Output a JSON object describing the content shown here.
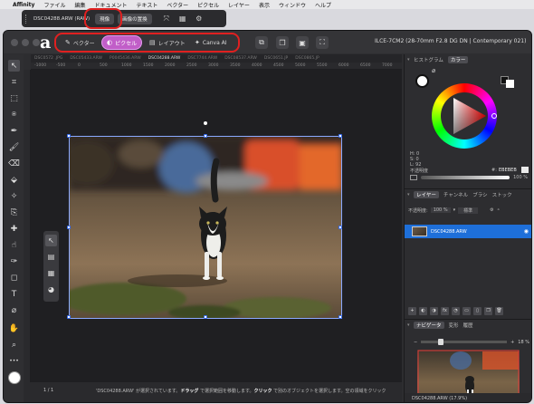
{
  "menubar": {
    "app": "Affinity",
    "items": [
      "ファイル",
      "編集",
      "ドキュメント",
      "テキスト",
      "ベクター",
      "ピクセル",
      "レイヤー",
      "表示",
      "ウィンドウ",
      "ヘルプ"
    ]
  },
  "context_toolbar": {
    "filename": "DSC04288.ARW (RAW)",
    "btn_image": "現像",
    "btn_replace": "画像の置換"
  },
  "personas": {
    "vector": "ベクター",
    "pixel": "ピクセル",
    "layout": "レイアウト",
    "canva": "Canva AI"
  },
  "doc_info": "ILCE-7CM2 (28-70mm F2.8 DG DN | Contemporary 021)",
  "tabs": [
    "DSC0572 .JPG",
    "DSC05433.ARW",
    "P0045436.ARW",
    "DSC04288.ARW",
    "DSC7744.ARW",
    "DSC08537.ARW",
    "DSC0651.JP",
    "DSC0865.JP"
  ],
  "ruler_ticks": [
    "-1000",
    "-500",
    "0",
    "500",
    "1000",
    "1500",
    "2000",
    "2500",
    "3000",
    "3500",
    "4000",
    "4500",
    "5000",
    "5500",
    "6000",
    "6500",
    "7000"
  ],
  "status": {
    "page": "1 / 1",
    "msg_prefix": "'DSC04288.ARW' が選択されています。",
    "drag": "ドラッグ",
    "msg_mid": " で選択範囲を移動します。",
    "click": "クリック",
    "msg_suffix": " で別のオブジェクトを選択します。空の領域をクリック"
  },
  "color_panel": {
    "tabs": [
      "ヒストグラム",
      "カラー"
    ],
    "active_tab": "カラー",
    "h": "H: 0",
    "s": "S: 0",
    "l": "L: 92",
    "hex_label": "#:",
    "hex_value": "EBEBEB",
    "opacity_label": "不透明度",
    "opacity_value": "100 %"
  },
  "layers_panel": {
    "tabs": [
      "レイヤー",
      "チャンネル",
      "ブラシ",
      "ストック"
    ],
    "opacity_label": "不透明度:",
    "opacity_value": "100 %",
    "blend_mode": "標準",
    "layer_name": "DSC04288.ARW"
  },
  "navigator_panel": {
    "tabs": [
      "ナビゲータ",
      "変形",
      "履歴"
    ],
    "zoom_value": "18 %",
    "caption": "DSC04288.ARW (17.9%)"
  },
  "icons": [
    "apple-icon",
    "move-tool-icon",
    "crop-tool-icon",
    "brush-tool-icon",
    "pen-tool-icon",
    "hand-tool-icon",
    "zoom-tool-icon",
    "eye-icon",
    "settings-icon"
  ]
}
